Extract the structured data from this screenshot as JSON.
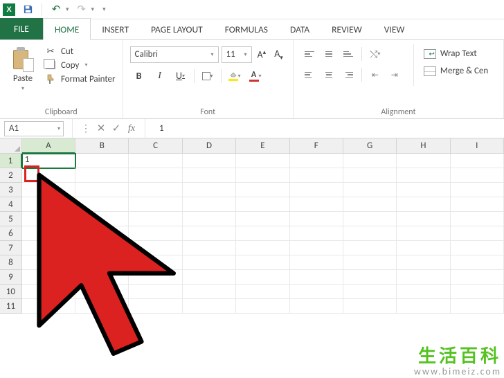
{
  "tabs": {
    "file": "FILE",
    "home": "HOME",
    "insert": "INSERT",
    "page_layout": "PAGE LAYOUT",
    "formulas": "FORMULAS",
    "data": "DATA",
    "review": "REVIEW",
    "view": "VIEW"
  },
  "clipboard": {
    "paste": "Paste",
    "cut": "Cut",
    "copy": "Copy",
    "format_painter": "Format Painter",
    "group": "Clipboard"
  },
  "font": {
    "name": "Calibri",
    "size": "11",
    "bold": "B",
    "italic": "I",
    "underline": "U",
    "color_letter": "A",
    "group": "Font"
  },
  "alignment": {
    "wrap": "Wrap Text",
    "merge": "Merge & Cen",
    "group": "Alignment"
  },
  "formula_bar": {
    "name_box": "A1",
    "value": "1"
  },
  "grid": {
    "cols": [
      "A",
      "B",
      "C",
      "D",
      "E",
      "F",
      "G",
      "H",
      "I"
    ],
    "rows": [
      "1",
      "2",
      "3",
      "4",
      "5",
      "6",
      "7",
      "8",
      "9",
      "10",
      "11"
    ],
    "active_cell_value": "1"
  },
  "watermark": {
    "zh": "生活百科",
    "url": "www.bimeiz.com"
  }
}
